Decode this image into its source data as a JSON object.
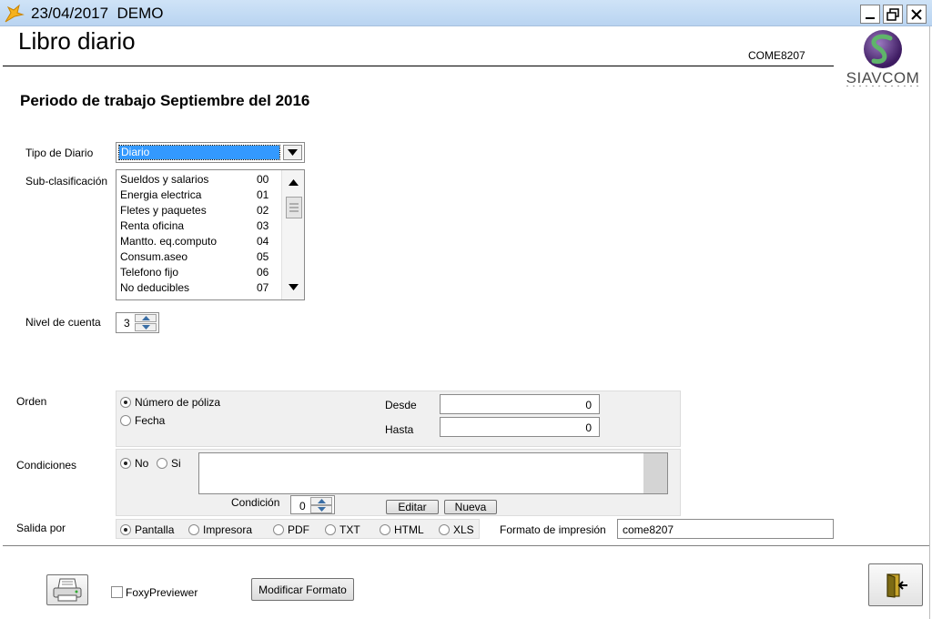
{
  "window": {
    "title": "23/04/2017  DEMO",
    "minimize": "_",
    "maximize": "🗗",
    "close": "✕"
  },
  "header": {
    "title": "Libro diario",
    "code": "COME8207",
    "logo_text": "SIAVCOM"
  },
  "periodo": "Periodo de trabajo Septiembre del 2016",
  "tipo_diario": {
    "label": "Tipo de Diario",
    "value": "Diario"
  },
  "subclasificacion": {
    "label": "Sub-clasificación",
    "items": [
      {
        "name": "Sueldos y salarios",
        "code": "00"
      },
      {
        "name": "Energia electrica",
        "code": "01"
      },
      {
        "name": "Fletes y paquetes",
        "code": "02"
      },
      {
        "name": "Renta oficina",
        "code": "03"
      },
      {
        "name": "Mantto. eq.computo",
        "code": "04"
      },
      {
        "name": "Consum.aseo",
        "code": "05"
      },
      {
        "name": "Telefono fijo",
        "code": "06"
      },
      {
        "name": "No deducibles",
        "code": "07"
      }
    ]
  },
  "nivel_cuenta": {
    "label": "Nivel de cuenta",
    "value": "3"
  },
  "orden": {
    "label": "Orden",
    "options": [
      "Número de póliza",
      "Fecha"
    ],
    "selected": 0,
    "desde_label": "Desde",
    "desde_value": "0",
    "hasta_label": "Hasta",
    "hasta_value": "0"
  },
  "condiciones": {
    "label": "Condiciones",
    "options": [
      "No",
      "Si"
    ],
    "selected": 0,
    "condicion_label": "Condición",
    "condicion_value": "0",
    "editar": "Editar",
    "nueva": "Nueva"
  },
  "salida": {
    "label": "Salida por",
    "options": [
      "Pantalla",
      "Impresora",
      "PDF",
      "TXT",
      "HTML",
      "XLS"
    ],
    "selected": 0,
    "formato_label": "Formato de impresión",
    "formato_value": "come8207"
  },
  "footer": {
    "foxy_label": "FoxyPreviewer",
    "modificar": "Modificar Formato"
  },
  "colors": {
    "titlebar": "#c4dcf4",
    "selection": "#3399ff",
    "panel": "#f0f0f0",
    "logo_purple": "#5a2d82",
    "logo_green": "#4c9a54"
  }
}
